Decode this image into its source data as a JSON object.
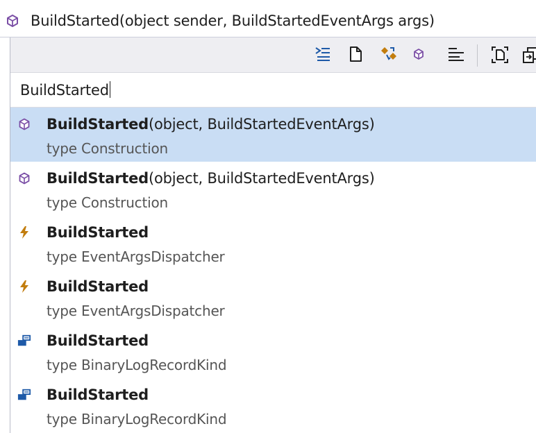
{
  "window": {
    "signature": "BuildStarted(object sender, BuildStartedEventArgs args)",
    "icon": "method-cube-icon"
  },
  "toolbar": {
    "buttons": [
      "expand-lines-icon",
      "document-icon",
      "event-link-icon",
      "method-cube-icon",
      "align-lines-icon",
      "select-region-icon",
      "copy-icon"
    ]
  },
  "search": {
    "value": "BuildStarted"
  },
  "results": [
    {
      "name": "BuildStarted",
      "params": "(object, BuildStartedEventArgs)",
      "type_line": "type Construction",
      "icon": "method-cube-icon",
      "selected": true
    },
    {
      "name": "BuildStarted",
      "params": "(object, BuildStartedEventArgs)",
      "type_line": "type Construction",
      "icon": "method-cube-icon",
      "selected": false
    },
    {
      "name": "BuildStarted",
      "params": "",
      "type_line": "type EventArgsDispatcher",
      "icon": "event-bolt-icon",
      "selected": false
    },
    {
      "name": "BuildStarted",
      "params": "",
      "type_line": "type EventArgsDispatcher",
      "icon": "event-bolt-icon",
      "selected": false
    },
    {
      "name": "BuildStarted",
      "params": "",
      "type_line": "type BinaryLogRecordKind",
      "icon": "enum-member-icon",
      "selected": false
    },
    {
      "name": "BuildStarted",
      "params": "",
      "type_line": "type BinaryLogRecordKind",
      "icon": "enum-member-icon",
      "selected": false
    }
  ],
  "colors": {
    "selected_bg": "#c9ddf4",
    "toolbar_bg": "#eeeef2",
    "method_purple": "#7b4fa6",
    "event_orange": "#c27d0e",
    "enum_blue": "#1e5aa8"
  }
}
